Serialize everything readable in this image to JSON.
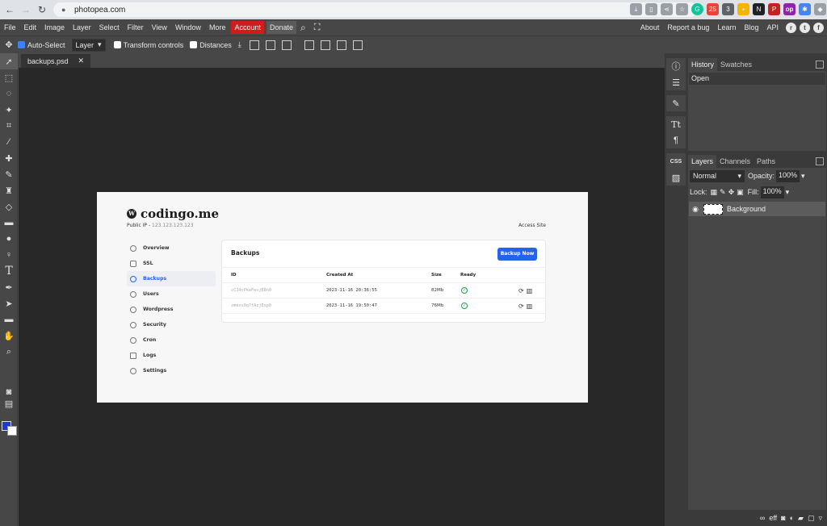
{
  "browser": {
    "url": "photopea.com",
    "ext_badge_1": "25",
    "ext_badge_2": "3"
  },
  "menubar": {
    "items": [
      "File",
      "Edit",
      "Image",
      "Layer",
      "Select",
      "Filter",
      "View",
      "Window",
      "More"
    ],
    "account": "Account",
    "donate": "Donate",
    "right_items": [
      "About",
      "Report a bug",
      "Learn",
      "Blog",
      "API"
    ]
  },
  "options": {
    "auto_select": "Auto-Select",
    "layer_select": "Layer",
    "transform_controls": "Transform controls",
    "distances": "Distances"
  },
  "document": {
    "tab_name": "backups.psd"
  },
  "site": {
    "title": "codingo.me",
    "public_ip_label": "Public IP - ",
    "public_ip": "123.123.123.123",
    "access_site": "Access Site",
    "nav": [
      "Overview",
      "SSL",
      "Backups",
      "Users",
      "Wordpress",
      "Security",
      "Cron",
      "Logs",
      "Settings"
    ],
    "card_title": "Backups",
    "backup_button": "Backup Now",
    "table_headers": [
      "ID",
      "Created At",
      "Size",
      "Ready"
    ],
    "rows": [
      {
        "id": "cCJ4cPkeFwvjE8n0",
        "created": "2023-11-16 20:36:55",
        "size": "82Mb"
      },
      {
        "id": "zmexs0q7fAzjEsp0",
        "created": "2023-11-16 19:50:47",
        "size": "76Mb"
      }
    ]
  },
  "panels": {
    "history_tabs": [
      "History",
      "Swatches"
    ],
    "history_items": [
      "Open"
    ],
    "layers_tabs": [
      "Layers",
      "Channels",
      "Paths"
    ],
    "blend_mode": "Normal",
    "opacity_label": "Opacity:",
    "opacity_value": "100%",
    "lock_label": "Lock:",
    "fill_label": "Fill:",
    "fill_value": "100%",
    "layer_name": "Background",
    "strip_css_label": "CSS"
  },
  "colors": {
    "foreground": "#1e3bcf",
    "background": "#ffffff",
    "account_red": "#d31b1b",
    "accent_blue": "#2563eb"
  }
}
